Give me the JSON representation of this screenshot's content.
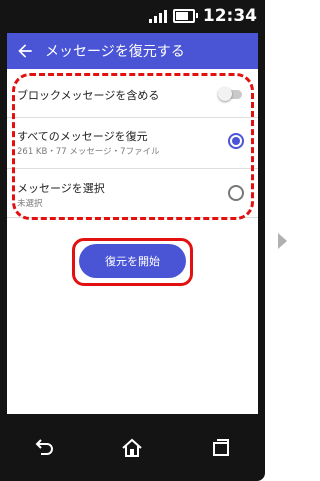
{
  "status_bar": {
    "time": "12:34"
  },
  "app_bar": {
    "title": "メッセージを復元する"
  },
  "options": {
    "include_blocked": {
      "label": "ブロックメッセージを含める",
      "enabled": false
    },
    "restore_all": {
      "label": "すべてのメッセージを復元",
      "detail": "261 KB・77 メッセージ・7ファイル",
      "selected": true
    },
    "select_messages": {
      "label": "メッセージを選択",
      "detail": "未選択",
      "selected": false
    }
  },
  "start_button": {
    "label": "復元を開始"
  },
  "colors": {
    "accent": "#4a55d6",
    "highlight": "#e31010"
  },
  "nav_icons": [
    "back-icon",
    "home-icon",
    "recent-apps-icon"
  ]
}
